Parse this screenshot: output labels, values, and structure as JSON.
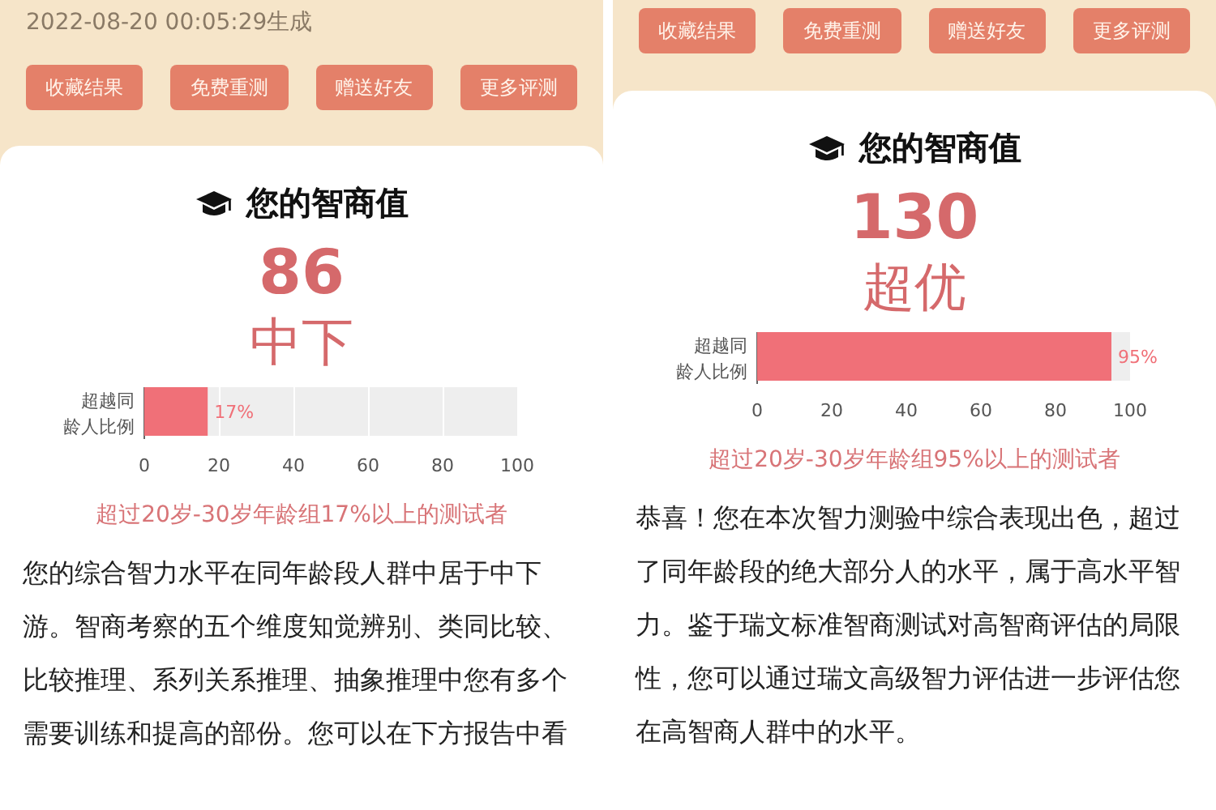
{
  "panels": [
    {
      "timestamp": "2022-08-20 00:05:29生成",
      "buttons": [
        "收藏结果",
        "免费重测",
        "赠送好友",
        "更多评测"
      ],
      "card": {
        "title": "您的智商值",
        "score": "86",
        "rating": "中下",
        "chart_data": {
          "type": "bar",
          "orientation": "horizontal",
          "categories": [
            "超越同龄人比例"
          ],
          "series": [
            {
              "color": "#f07078",
              "values": [
                17
              ]
            }
          ],
          "xlim": [
            0,
            100
          ],
          "xticks": [
            0,
            20,
            40,
            60,
            80,
            100
          ],
          "value_labels": [
            "17%"
          ]
        },
        "caption": "超过20岁-30岁年龄组17%以上的测试者",
        "paragraph": "您的综合智力水平在同年龄段人群中居于中下游。智商考察的五个维度知觉辨别、类同比较、比较推理、系列关系推理、抽象推理中您有多个需要训练和提高的部份。您可以在下方报告中看"
      }
    },
    {
      "buttons": [
        "收藏结果",
        "免费重测",
        "赠送好友",
        "更多评测"
      ],
      "card": {
        "title": "您的智商值",
        "score": "130",
        "rating": "超优",
        "chart_data": {
          "type": "bar",
          "orientation": "horizontal",
          "categories": [
            "超越同龄人比例"
          ],
          "series": [
            {
              "color": "#f07078",
              "values": [
                95
              ]
            }
          ],
          "xlim": [
            0,
            100
          ],
          "xticks": [
            0,
            20,
            40,
            60,
            80,
            100
          ],
          "value_labels": [
            "95%"
          ]
        },
        "caption": "超过20岁-30岁年龄组95%以上的测试者",
        "paragraph": "恭喜！您在本次智力测验中综合表现出色，超过了同年龄段的绝大部分人的水平，属于高水平智力。鉴于瑞文标准智商测试对高智商评估的局限性，您可以通过瑞文高级智力评估进一步评估您在高智商人群中的水平。"
      }
    }
  ]
}
